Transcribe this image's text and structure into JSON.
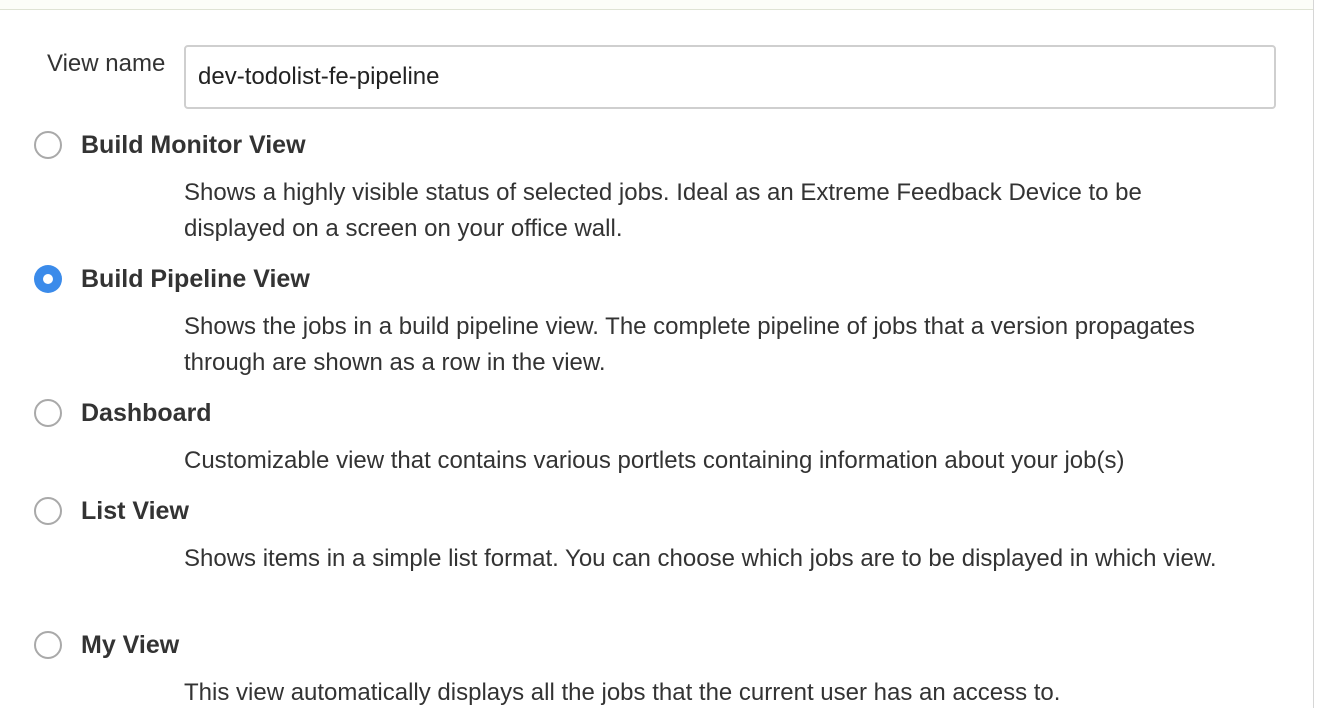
{
  "form": {
    "name_label": "View name",
    "name_value": "dev-todolist-fe-pipeline"
  },
  "options": [
    {
      "title": "Build Monitor View",
      "description": "Shows a highly visible status of selected jobs. Ideal as an Extreme Feedback Device to be displayed on a screen on your office wall.",
      "selected": false
    },
    {
      "title": "Build Pipeline View",
      "description": "Shows the jobs in a build pipeline view. The complete pipeline of jobs that a version propagates through are shown as a row in the view.",
      "selected": true
    },
    {
      "title": "Dashboard",
      "description": "Customizable view that contains various portlets containing information about your job(s)",
      "selected": false
    },
    {
      "title": "List View",
      "description": "Shows items in a simple list format. You can choose which jobs are to be displayed in which view.",
      "selected": false
    },
    {
      "title": "My View",
      "description": "This view automatically displays all the jobs that the current user has an access to.",
      "selected": false
    }
  ],
  "colors": {
    "accent": "#3b8bea",
    "text": "#333333",
    "input_border": "#cfcfcf"
  }
}
